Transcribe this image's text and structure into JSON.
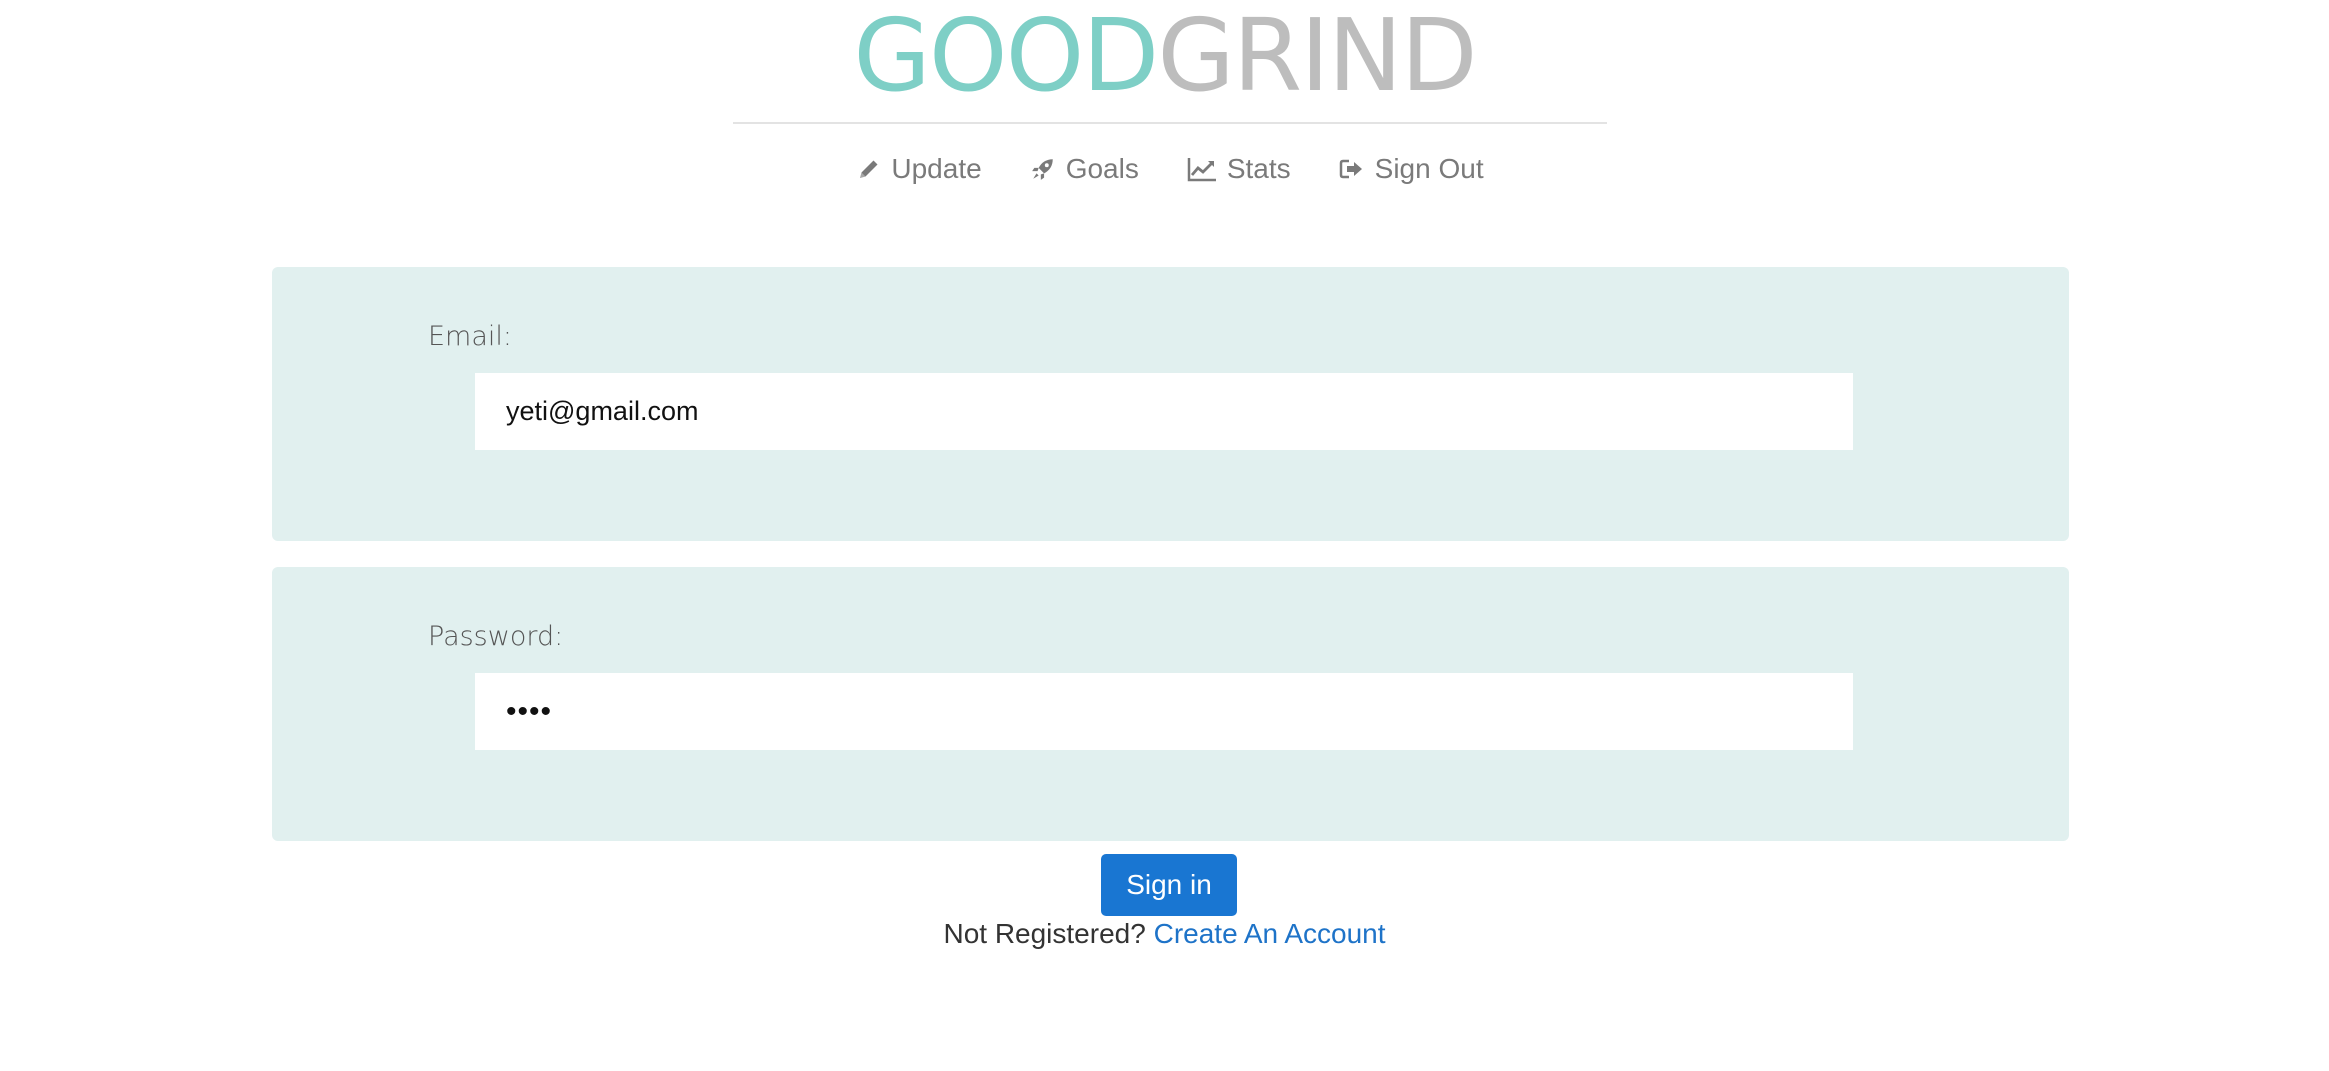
{
  "brand": {
    "part1": "GOOD",
    "part2": "GRIND",
    "color_part1": "#7ecfc6",
    "color_part2": "#bdbdbd"
  },
  "nav": {
    "items": [
      {
        "label": "Update",
        "icon": "pencil-icon"
      },
      {
        "label": "Goals",
        "icon": "rocket-icon"
      },
      {
        "label": "Stats",
        "icon": "line-chart-icon"
      },
      {
        "label": "Sign Out",
        "icon": "sign-out-icon"
      }
    ]
  },
  "form": {
    "email_label": "Email:",
    "email_value": "yeti@gmail.com",
    "password_label": "Password:",
    "password_value": "••••",
    "submit_label": "Sign in"
  },
  "footer": {
    "prompt": "Not Registered?",
    "link_label": "Create An Account"
  },
  "colors": {
    "panel_bg": "#e1f0ef",
    "button_bg": "#1976d2",
    "link": "#1e73c8",
    "nav_text": "#7a7a7a"
  }
}
